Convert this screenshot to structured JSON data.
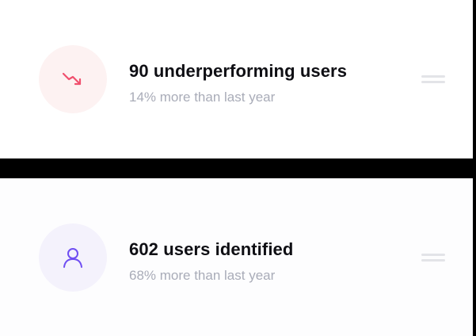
{
  "cards": [
    {
      "title": "90 underperforming users",
      "subtitle": "14% more than last year",
      "icon": "trend-down-icon",
      "accent": "#f0506e",
      "icon_bg": "#fdf2f2"
    },
    {
      "title": "602 users identified",
      "subtitle": "68% more than last year",
      "icon": "user-icon",
      "accent": "#6f4ef2",
      "icon_bg": "#f4f2fc"
    }
  ],
  "colors": {
    "title": "#0f0f14",
    "subtitle": "#a9acb8",
    "handle": "#e3e4e8",
    "divider": "#000000"
  }
}
